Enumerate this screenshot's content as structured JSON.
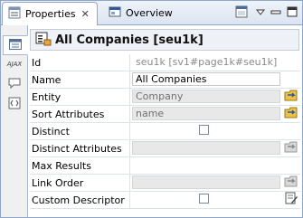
{
  "tabs": {
    "properties_label": "Properties",
    "overview_label": "Overview",
    "close_glyph": "✕"
  },
  "left_tabs": {
    "ajax_label": "AJAX"
  },
  "header": {
    "title": "All Companies [seu1k]"
  },
  "rows": [
    {
      "label": "Id",
      "value": "seu1k  [sv1#page1k#seu1k]",
      "style": "plain",
      "disabled": false
    },
    {
      "label": "Name",
      "value": "All Companies",
      "style": "white",
      "disabled": false
    },
    {
      "label": "Entity",
      "value": "Company",
      "style": "gray",
      "disabled": false
    },
    {
      "label": "Sort Attributes",
      "value": "name",
      "style": "gray",
      "disabled": false
    },
    {
      "label": "Distinct",
      "value": "",
      "style": "checkbox",
      "disabled": false
    },
    {
      "label": "Distinct Attributes",
      "value": "",
      "style": "gray",
      "disabled": true
    },
    {
      "label": "Max Results",
      "value": "",
      "style": "none",
      "disabled": false
    },
    {
      "label": "Link Order",
      "value": "",
      "style": "gray",
      "disabled": true
    },
    {
      "label": "Custom Descriptor",
      "value": "",
      "style": "checkbox",
      "disabled": false
    }
  ],
  "colors": {
    "accent": "#8fa6c8",
    "disabled_text": "#8c8c8c",
    "field_gray": "#e8e8e8"
  }
}
